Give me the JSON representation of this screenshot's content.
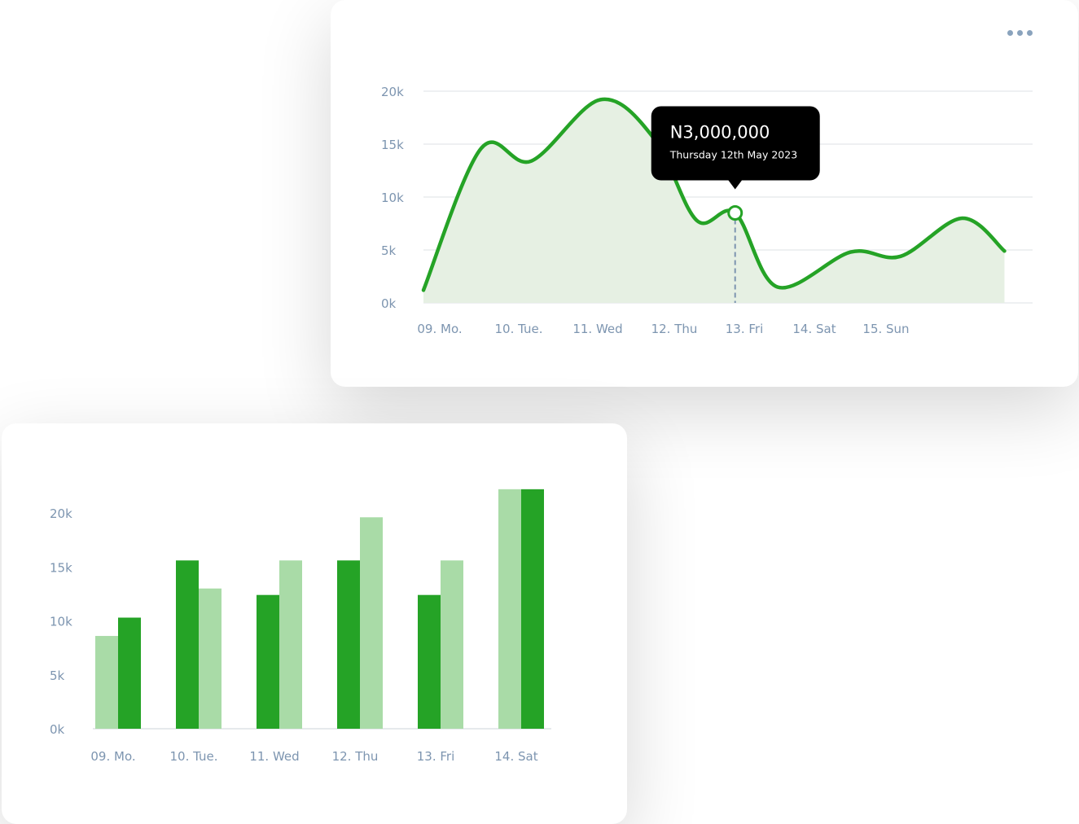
{
  "colors": {
    "primary_green": "#25a326",
    "light_green": "#a9dba7",
    "area_fill": "#e6f0e3",
    "grid": "#dde2e6",
    "axis_text": "#7d95b0",
    "tooltip_bg": "#000000"
  },
  "top_card": {
    "menu_icon": "more-dots-icon"
  },
  "chart_data": [
    {
      "type": "area",
      "y_ticks": [
        "20k",
        "15k",
        "10k",
        "5k",
        "0k"
      ],
      "x_tick_labels": [
        "09. Mo.",
        "10. Tue.",
        "11. Wed",
        "12. Thu",
        "13. Fri",
        "14. Sat",
        "15. Sun"
      ],
      "ylim": [
        0,
        20000
      ],
      "grid": true,
      "points": [
        {
          "x": 0.0,
          "y": 1200
        },
        {
          "x": 0.75,
          "y": 14600
        },
        {
          "x": 1.4,
          "y": 13400
        },
        {
          "x": 2.3,
          "y": 19200
        },
        {
          "x": 3.0,
          "y": 15500
        },
        {
          "x": 3.55,
          "y": 7800
        },
        {
          "x": 4.05,
          "y": 8500
        },
        {
          "x": 4.6,
          "y": 1500
        },
        {
          "x": 5.55,
          "y": 4800
        },
        {
          "x": 6.2,
          "y": 4400
        },
        {
          "x": 7.0,
          "y": 8000
        },
        {
          "x": 7.55,
          "y": 4900
        }
      ],
      "highlight": {
        "x": 4.05,
        "y": 8500,
        "value_label": "N3,000,000",
        "date_label": "Thursday 12th May 2023"
      }
    },
    {
      "type": "bar",
      "y_ticks": [
        "20k",
        "15k",
        "10k",
        "5k",
        "0k"
      ],
      "categories": [
        "09. Mo.",
        "10. Tue.",
        "11. Wed",
        "12. Thu",
        "13. Fri",
        "14. Sat"
      ],
      "ylim": [
        0,
        20000
      ],
      "grid": false,
      "pairs": [
        [
          {
            "value": 8600,
            "tone": "light"
          },
          {
            "value": 10300,
            "tone": "dark"
          }
        ],
        [
          {
            "value": 15600,
            "tone": "dark"
          },
          {
            "value": 13000,
            "tone": "light"
          }
        ],
        [
          {
            "value": 12400,
            "tone": "dark"
          },
          {
            "value": 15600,
            "tone": "light"
          }
        ],
        [
          {
            "value": 15600,
            "tone": "dark"
          },
          {
            "value": 19600,
            "tone": "light"
          }
        ],
        [
          {
            "value": 12400,
            "tone": "dark"
          },
          {
            "value": 15600,
            "tone": "light"
          }
        ],
        [
          {
            "value": 22200,
            "tone": "light"
          },
          {
            "value": 22200,
            "tone": "dark"
          }
        ]
      ]
    }
  ]
}
